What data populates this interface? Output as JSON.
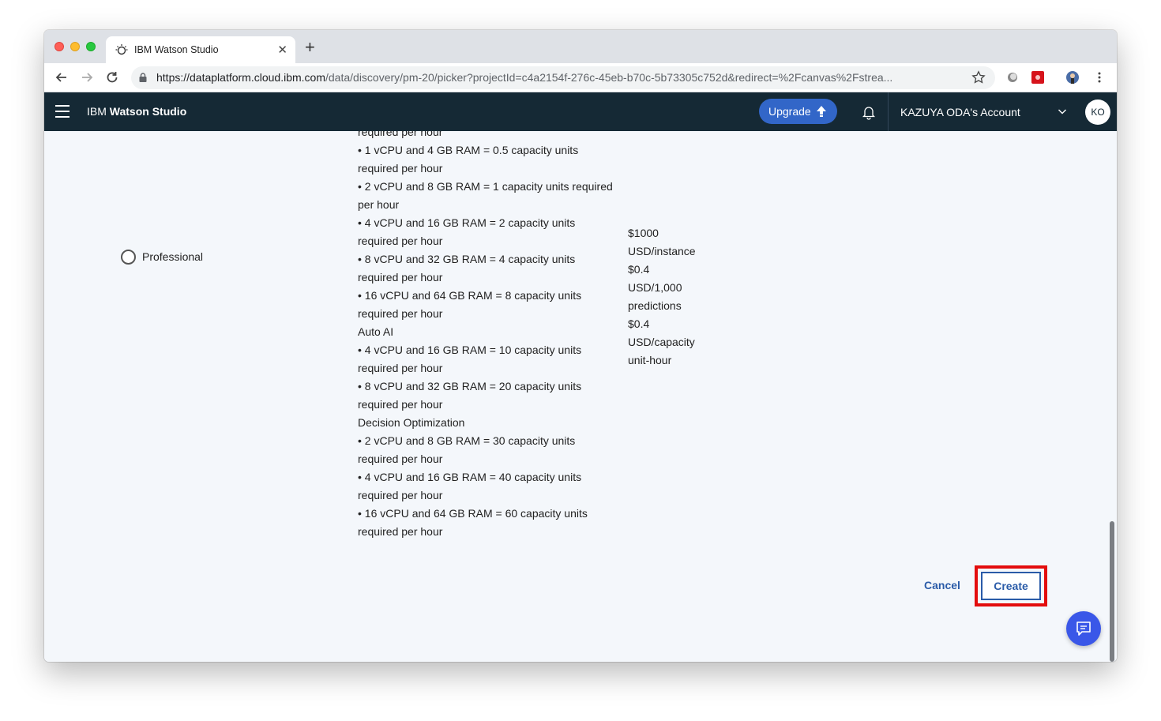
{
  "browser": {
    "tab_title": "IBM Watson Studio",
    "url_host": "https://dataplatform.cloud.ibm.com",
    "url_path": "/data/discovery/pm-20/picker?projectId=c4a2154f-276c-45eb-b70c-5b73305c752d&redirect=%2Fcanvas%2Fstrea..."
  },
  "header": {
    "brand_prefix": "IBM",
    "brand_name": "Watson Studio",
    "upgrade_label": "Upgrade",
    "account_name": "KAZUYA ODA's Account",
    "avatar_initials": "KO"
  },
  "plan": {
    "name": "Professional",
    "specs_cut_top": "required per hour",
    "specs": [
      "• 1 vCPU and 4 GB RAM = 0.5 capacity units",
      "required per hour",
      "• 2 vCPU and 8 GB RAM = 1 capacity units required",
      "per hour",
      "• 4 vCPU and 16 GB RAM = 2 capacity units",
      "required per hour",
      "• 8 vCPU and 32 GB RAM = 4 capacity units",
      "required per hour",
      "• 16 vCPU and 64 GB RAM = 8 capacity units",
      "required per hour",
      "Auto AI",
      "• 4 vCPU and 16 GB RAM = 10 capacity units",
      "required per hour",
      "• 8 vCPU and 32 GB RAM = 20 capacity units",
      "required per hour",
      "Decision Optimization",
      "• 2 vCPU and 8 GB RAM = 30 capacity units",
      "required per hour",
      "• 4 vCPU and 16 GB RAM = 40 capacity units",
      "required per hour",
      "• 16 vCPU and 64 GB RAM = 60 capacity units",
      "required per hour"
    ],
    "prices": [
      "$1000 USD/instance",
      "$0.4 USD/1,000 predictions",
      "$0.4 USD/capacity unit-hour"
    ]
  },
  "actions": {
    "cancel_label": "Cancel",
    "create_label": "Create"
  }
}
